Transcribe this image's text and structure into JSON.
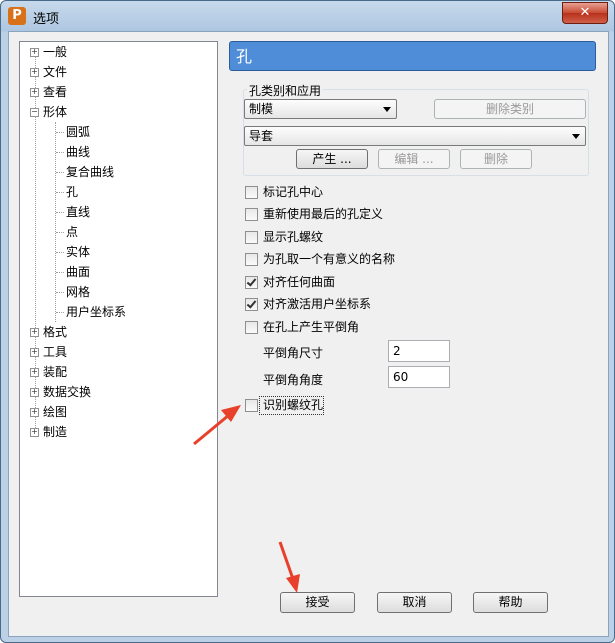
{
  "window": {
    "title": "选项",
    "app_icon_letter": "P"
  },
  "tree": {
    "items": [
      {
        "label": "一般",
        "level": 0,
        "expander": "+"
      },
      {
        "label": "文件",
        "level": 0,
        "expander": "+"
      },
      {
        "label": "查看",
        "level": 0,
        "expander": "+"
      },
      {
        "label": "形体",
        "level": 0,
        "expander": "-"
      },
      {
        "label": "圆弧",
        "level": 1
      },
      {
        "label": "曲线",
        "level": 1
      },
      {
        "label": "复合曲线",
        "level": 1
      },
      {
        "label": "孔",
        "level": 1
      },
      {
        "label": "直线",
        "level": 1
      },
      {
        "label": "点",
        "level": 1
      },
      {
        "label": "实体",
        "level": 1
      },
      {
        "label": "曲面",
        "level": 1
      },
      {
        "label": "网格",
        "level": 1
      },
      {
        "label": "用户坐标系",
        "level": 1
      },
      {
        "label": "格式",
        "level": 0,
        "expander": "+"
      },
      {
        "label": "工具",
        "level": 0,
        "expander": "+"
      },
      {
        "label": "装配",
        "level": 0,
        "expander": "+"
      },
      {
        "label": "数据交换",
        "level": 0,
        "expander": "+"
      },
      {
        "label": "绘图",
        "level": 0,
        "expander": "+"
      },
      {
        "label": "制造",
        "level": 0,
        "expander": "+"
      }
    ]
  },
  "panel": {
    "title": "孔",
    "group_label": "孔类别和应用",
    "category_select": "制模",
    "delete_category_label": "删除类别",
    "application_select": "导套",
    "create_label": "产生 ...",
    "edit_label": "编辑 ...",
    "delete_label": "删除",
    "checkboxes": [
      {
        "label": "标记孔中心",
        "checked": false
      },
      {
        "label": "重新使用最后的孔定义",
        "checked": false
      },
      {
        "label": "显示孔螺纹",
        "checked": false
      },
      {
        "label": "为孔取一个有意义的名称",
        "checked": false
      },
      {
        "label": "对齐任何曲面",
        "checked": true
      },
      {
        "label": "对齐激活用户坐标系",
        "checked": true
      },
      {
        "label": "在孔上产生平倒角",
        "checked": false
      }
    ],
    "chamfer_size_label": "平倒角尺寸",
    "chamfer_size_value": "2",
    "chamfer_angle_label": "平倒角角度",
    "chamfer_angle_value": "60",
    "thread_checkbox": {
      "label": "识别螺纹孔",
      "checked": false
    }
  },
  "footer": {
    "accept_label": "接受",
    "cancel_label": "取消",
    "help_label": "帮助"
  },
  "annotation": {
    "arrow_color": "#e8402a"
  }
}
